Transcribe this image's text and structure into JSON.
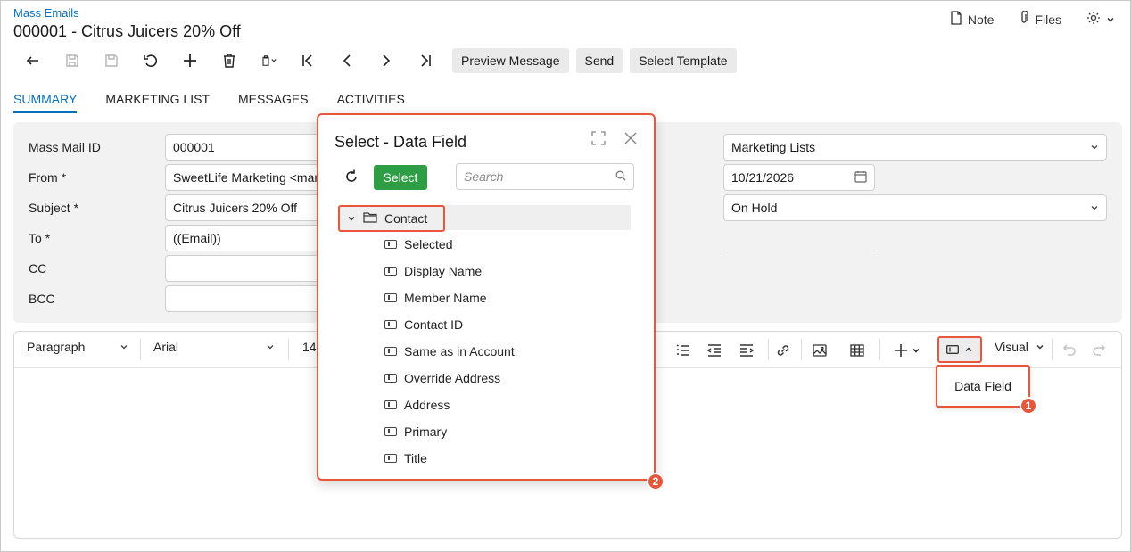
{
  "header": {
    "breadcrumb": "Mass Emails",
    "title": "000001 - Citrus Juicers 20% Off",
    "note_label": "Note",
    "files_label": "Files"
  },
  "toolbar": {
    "preview_label": "Preview Message",
    "send_label": "Send",
    "template_label": "Select Template"
  },
  "tabs": [
    {
      "label": "SUMMARY"
    },
    {
      "label": "MARKETING LIST"
    },
    {
      "label": "MESSAGES"
    },
    {
      "label": "ACTIVITIES"
    }
  ],
  "form": {
    "mass_mail_id_label": "Mass Mail ID",
    "mass_mail_id_value": "000001",
    "from_label": "From",
    "from_value": "SweetLife Marketing <mar",
    "subject_label": "Subject",
    "subject_value": "Citrus Juicers 20% Off",
    "to_label": "To",
    "to_value": "((Email))",
    "cc_label": "CC",
    "bcc_label": "BCC",
    "required_mark": "*",
    "source_value": "Marketing Lists",
    "date_value": "10/21/2026",
    "status_value": "On Hold"
  },
  "editor": {
    "paragraph": "Paragraph",
    "font": "Arial",
    "size": "14",
    "mode": "Visual",
    "data_field_menu_item": "Data Field"
  },
  "dialog": {
    "title": "Select - Data Field",
    "select_label": "Select",
    "search_placeholder": "Search",
    "root_label": "Contact",
    "items": [
      "Selected",
      "Display Name",
      "Member Name",
      "Contact ID",
      "Same as in Account",
      "Override Address",
      "Address",
      "Primary",
      "Title"
    ]
  },
  "markers": {
    "one": "1",
    "two": "2"
  },
  "colors": {
    "accent": "#0b6fb8",
    "highlight": "#e8573c",
    "select_button": "#2e9e44"
  }
}
